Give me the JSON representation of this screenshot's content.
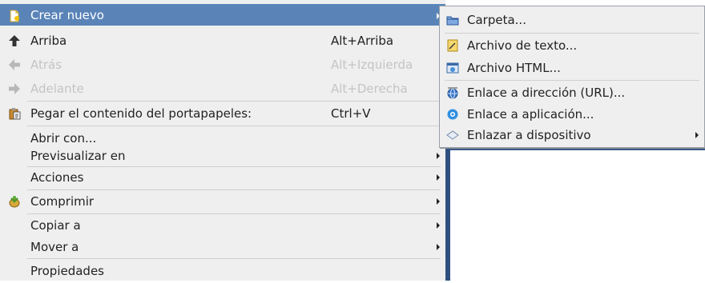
{
  "main_menu": {
    "items": [
      {
        "label": "Crear nuevo",
        "shortcut": "",
        "icon": "new-document-icon"
      },
      {
        "label": "Arriba",
        "shortcut": "Alt+Arriba",
        "icon": "arrow-up-icon"
      },
      {
        "label": "Atrás",
        "shortcut": "Alt+Izquierda",
        "icon": "arrow-left-icon"
      },
      {
        "label": "Adelante",
        "shortcut": "Alt+Derecha",
        "icon": "arrow-right-icon"
      },
      {
        "label": "Pegar el contenido del portapapeles:",
        "shortcut": "Ctrl+V",
        "icon": "paste-icon"
      },
      {
        "label": "Abrir con...",
        "shortcut": ""
      },
      {
        "label": "Previsualizar en",
        "shortcut": ""
      },
      {
        "label": "Acciones",
        "shortcut": ""
      },
      {
        "label": "Comprimir",
        "shortcut": "",
        "icon": "compress-icon"
      },
      {
        "label": "Copiar a",
        "shortcut": ""
      },
      {
        "label": "Mover a",
        "shortcut": ""
      },
      {
        "label": "Propiedades",
        "shortcut": ""
      }
    ]
  },
  "sub_menu": {
    "items": [
      {
        "label": "Carpeta...",
        "icon": "folder-icon"
      },
      {
        "label": "Archivo de texto...",
        "icon": "text-file-icon"
      },
      {
        "label": "Archivo HTML...",
        "icon": "html-file-icon"
      },
      {
        "label": "Enlace a dirección (URL)...",
        "icon": "url-link-icon"
      },
      {
        "label": "Enlace a aplicación...",
        "icon": "application-link-icon"
      },
      {
        "label": "Enlazar a dispositivo",
        "icon": "device-icon"
      }
    ]
  },
  "colors": {
    "highlight": "#5a84b8",
    "menu_background": "#efefef",
    "disabled_text": "#c4c4c4"
  }
}
